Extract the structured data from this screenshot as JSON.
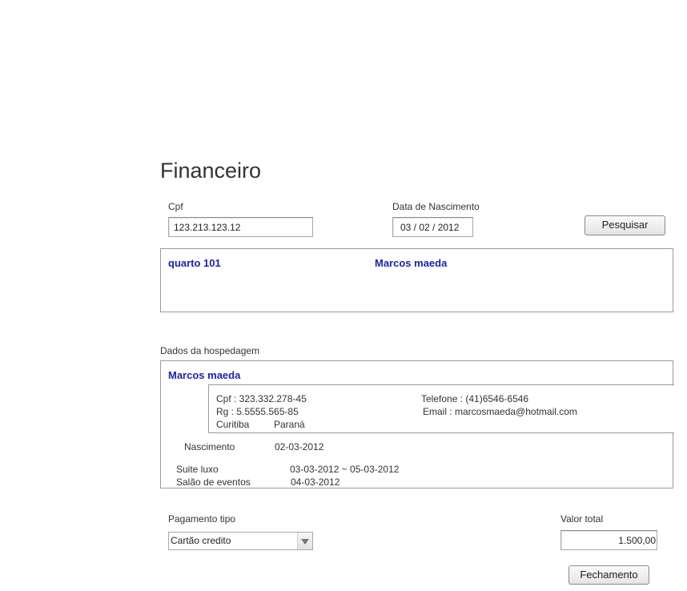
{
  "page": {
    "title": "Financeiro"
  },
  "search": {
    "cpf_label": "Cpf",
    "cpf_value": "123.213.123.12",
    "birth_label": "Data de Nascimento",
    "birth_value": "03 / 02 / 2012",
    "search_button": "Pesquisar"
  },
  "result": {
    "room": "quarto 101",
    "guest": "Marcos maeda"
  },
  "stay": {
    "section_label": "Dados da hospedagem",
    "guest_name": "Marcos maeda",
    "cpf": "Cpf : 323.332.278-45",
    "rg": "Rg : 5.5555.565-85",
    "city": "Curitiba",
    "state": "Paraná",
    "phone": "Telefone : (41)6546-6546",
    "email": "Email : marcosmaeda@hotmail.com",
    "birth_label": "Nascimento",
    "birth_value": "02-03-2012",
    "items": [
      {
        "name": "Suite luxo",
        "date": "03-03-2012 ~ 05-03-2012"
      },
      {
        "name": "Salão de eventos",
        "date": "04-03-2012"
      }
    ]
  },
  "payment": {
    "type_label": "Pagamento tipo",
    "type_value": "Cartão credito",
    "total_label": "Valor total",
    "total_value": "1.500,00",
    "close_button": "Fechamento"
  }
}
